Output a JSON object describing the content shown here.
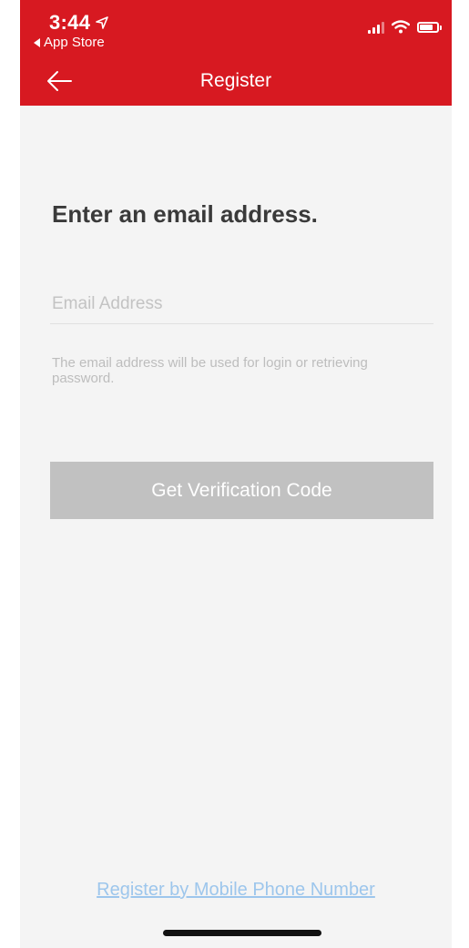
{
  "status_bar": {
    "time": "3:44",
    "back_to_app": "App Store"
  },
  "nav": {
    "title": "Register"
  },
  "form": {
    "heading": "Enter an email address.",
    "email_placeholder": "Email Address",
    "email_value": "",
    "hint": "The email address will be used for login or retrieving password.",
    "submit_label": "Get Verification Code"
  },
  "footer": {
    "alt_register_link": "Register by Mobile Phone Number"
  },
  "colors": {
    "header_bg": "#d71921",
    "page_bg": "#f4f4f4",
    "button_disabled": "#c1c1c1",
    "link": "#9dc6ec"
  }
}
